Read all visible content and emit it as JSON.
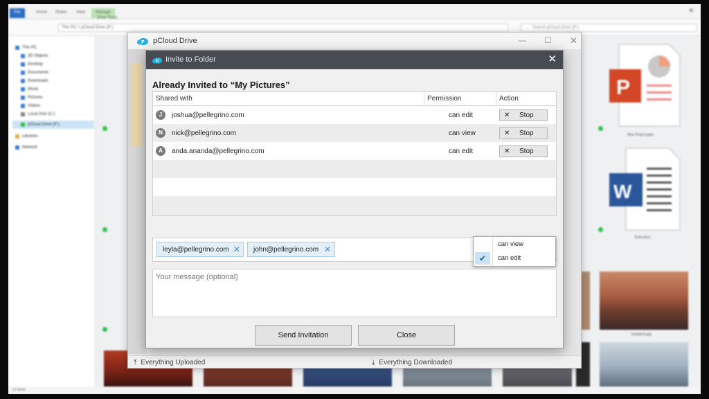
{
  "explorer": {
    "tabs": [
      "File",
      "Home",
      "Share",
      "View",
      "Manage",
      "Drive Tools"
    ],
    "address": "This PC  >  pCloud Drive (P:)",
    "search_placeholder": "Search pCloud Drive (P:)",
    "sidebar": [
      {
        "label": "This PC"
      },
      {
        "label": "3D Objects"
      },
      {
        "label": "Desktop"
      },
      {
        "label": "Documents"
      },
      {
        "label": "Downloads"
      },
      {
        "label": "Music"
      },
      {
        "label": "Pictures"
      },
      {
        "label": "Videos"
      },
      {
        "label": "Local Disk (C:)"
      },
      {
        "label": "pCloud Drive (P:)"
      },
      {
        "label": "Libraries"
      },
      {
        "label": "Network"
      }
    ],
    "status": "12 items",
    "file1": "New Project.pptx",
    "file2": "Texts.docx",
    "file3": "budapest.jpg"
  },
  "pcloud": {
    "title": "pCloud Drive",
    "status_uploaded": "Everything Uploaded",
    "status_downloaded": "Everything Downloaded"
  },
  "dialog": {
    "title": "Invite to Folder",
    "heading": "Already Invited to “My Pictures”",
    "columns": {
      "shared_with": "Shared with",
      "permission": "Permission",
      "action": "Action"
    },
    "rows": [
      {
        "initial": "J",
        "email": "joshua@pellegrino.com",
        "permission": "can edit",
        "action": "Stop"
      },
      {
        "initial": "N",
        "email": "nick@pellegrino.com",
        "permission": "can view",
        "action": "Stop"
      },
      {
        "initial": "A",
        "email": "anda.ananda@pellegrino.com",
        "permission": "can edit",
        "action": "Stop"
      }
    ],
    "chips": [
      "leyla@pellegrino.com",
      "john@pellegrino.com"
    ],
    "permission_options": [
      {
        "label": "can view",
        "selected": false
      },
      {
        "label": "can edit",
        "selected": true
      }
    ],
    "message_placeholder": "Your message (optional)",
    "send_label": "Send Invitation",
    "close_label": "Close"
  },
  "colors": {
    "dialog_titlebar": "#474b52",
    "chip_bg": "#e3f0fa",
    "check": "#1a5fa8",
    "pcloud_blue": "#20b0e8"
  }
}
